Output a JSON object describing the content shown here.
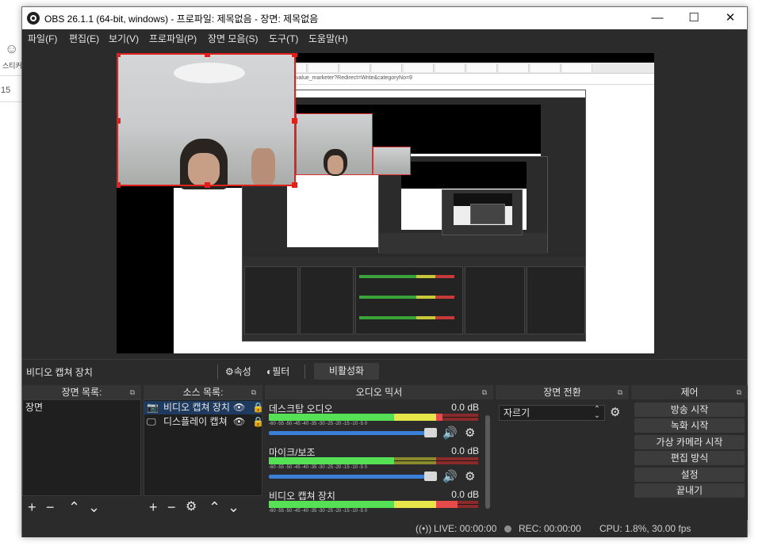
{
  "background": {
    "smile_icon": "smile-icon",
    "sticker_label": "스티커",
    "number_label": "15"
  },
  "window": {
    "title": "OBS 26.1.1 (64-bit, windows) - 프로파일: 제목없음 - 장면: 제목없음",
    "minimize_glyph": "—",
    "maximize_glyph": "☐",
    "close_glyph": "✕"
  },
  "menu": {
    "file": "파일(F)",
    "edit": "편집(E)",
    "view": "보기(V)",
    "profile": "프로파일(P)",
    "scene_collection": "장면 모음(S)",
    "tools": "도구(T)",
    "help": "도움말(H)"
  },
  "source_toolbar": {
    "source_name": "비디오 캡쳐 장치",
    "properties_label": "속성",
    "filters_label": "필터",
    "deactivate_label": "비활성화"
  },
  "scenes": {
    "header": "장면 목록:",
    "items": [
      "장면"
    ]
  },
  "sources": {
    "header": "소스 목록:",
    "items": [
      {
        "label": "비디오 캡쳐 장치",
        "icon": "camera-icon"
      },
      {
        "label": "디스플레이 캡쳐",
        "icon": "monitor-icon"
      }
    ]
  },
  "mixer": {
    "header": "오디오 믹서",
    "ticks": "-60  -55  -50  -45  -40  -35  -30  -25  -20  -15  -10  -5  0",
    "channels": [
      {
        "name": "데스크탑 오디오",
        "db": "0.0 dB",
        "level": 0.83
      },
      {
        "name": "마이크/보조",
        "db": "0.0 dB",
        "level": 0.6
      },
      {
        "name": "비디오 캡쳐 장치",
        "db": "0.0 dB",
        "level": 0.9
      }
    ]
  },
  "transitions": {
    "header": "장면 전환",
    "selected": "자르기"
  },
  "controls": {
    "header": "제어",
    "buttons": [
      "방송 시작",
      "녹화 시작",
      "가상 카메라 시작",
      "편집 방식",
      "설정",
      "끝내기"
    ]
  },
  "status": {
    "live": "LIVE: 00:00:00",
    "rec": "REC: 00:00:00",
    "cpu": "CPU: 1.8%, 30.00 fps"
  },
  "preview": {
    "address_text": "value_marketer?Redirect=Write&categoryNo=9"
  },
  "colors": {
    "accent_red": "#e0201a",
    "slider_blue": "#3a7fd8",
    "meter_green": "#55e055"
  }
}
